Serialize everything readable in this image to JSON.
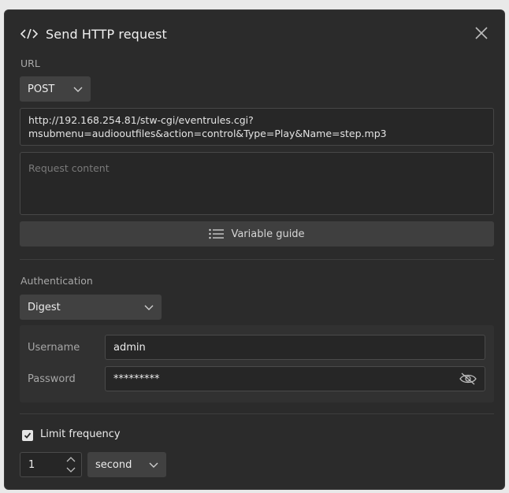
{
  "dialog": {
    "title": "Send HTTP request",
    "url_label": "URL",
    "method": "POST",
    "url_value_line1": "http://192.168.254.81/stw-cgi/eventrules.cgi?",
    "url_value_line2": "msubmenu=audiooutfiles&action=control&Type=Play&Name=step.mp3",
    "content_placeholder": "Request content",
    "variable_guide_label": "Variable guide"
  },
  "auth": {
    "label": "Authentication",
    "type": "Digest",
    "username_label": "Username",
    "username_value": "admin",
    "password_label": "Password",
    "password_value": "*********"
  },
  "frequency": {
    "checkbox_label": "Limit frequency",
    "checked": true,
    "value": "1",
    "unit": "second"
  },
  "colors": {
    "background": "#2b2b2b",
    "input_bg": "#262626",
    "select_bg": "#414141",
    "text": "#ececec",
    "muted": "#a8a8a8"
  },
  "icons": {
    "header": "code-icon",
    "close": "close-icon",
    "guide": "list-icon",
    "password_toggle": "eye-off-icon"
  }
}
